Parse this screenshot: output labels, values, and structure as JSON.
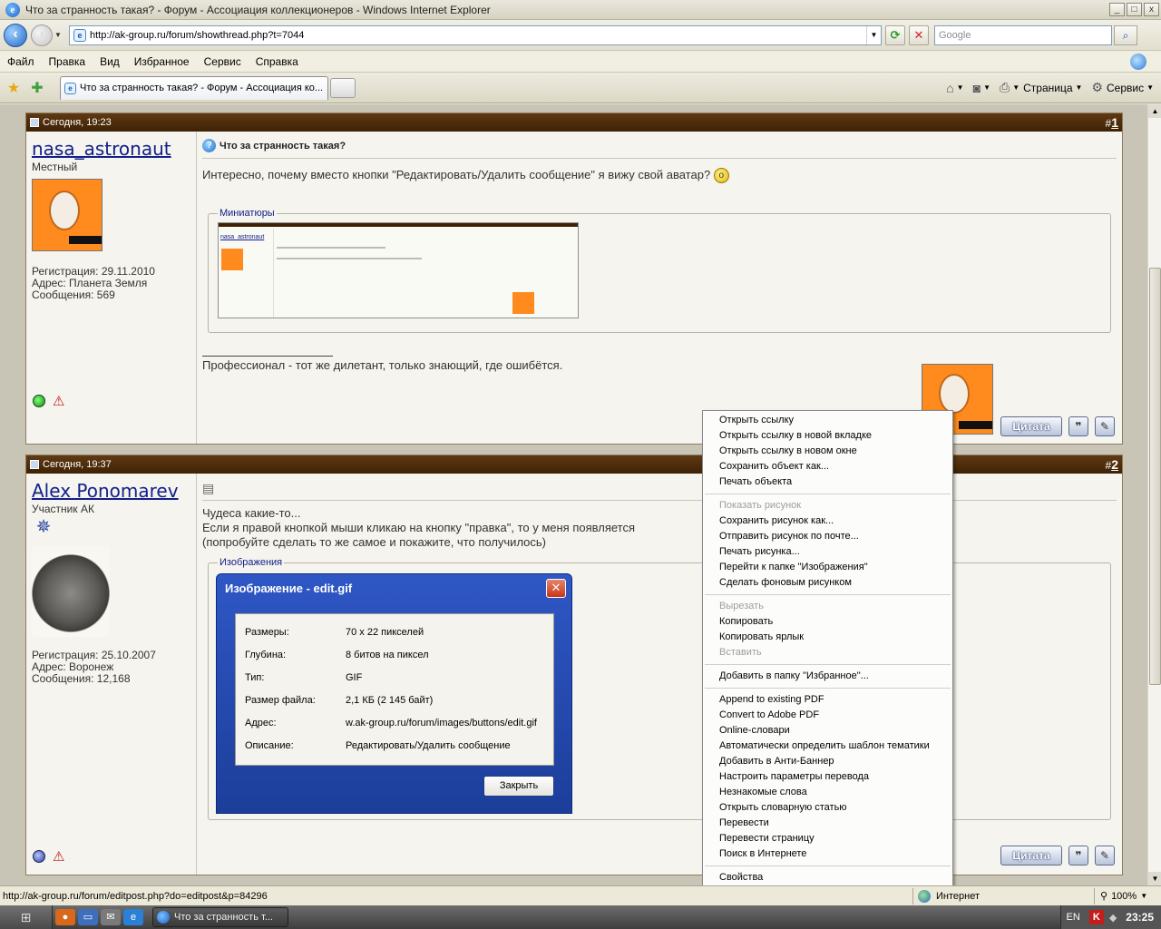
{
  "window": {
    "title": "Что за странность такая? - Форум - Ассоциация коллекционеров - Windows Internet Explorer",
    "minimize": "_",
    "maximize": "□",
    "close": "x"
  },
  "address": {
    "url": "http://ak-group.ru/forum/showthread.php?t=7044",
    "search_placeholder": "Google"
  },
  "menu": [
    "Файл",
    "Правка",
    "Вид",
    "Избранное",
    "Сервис",
    "Справка"
  ],
  "tab": {
    "label": "Что за странность такая? - Форум - Ассоциация ко..."
  },
  "toolbar_right": {
    "page": "Страница",
    "tools": "Сервис"
  },
  "posts": [
    {
      "date": "Сегодня, 19:23",
      "number_prefix": "#",
      "number": "1",
      "username": "nasa_astronaut",
      "usertitle": "Местный",
      "registration": "Регистрация: 29.11.2010",
      "location": "Адрес: Планета Земля",
      "messages": "Сообщения: 569",
      "title": "Что за странность такая?",
      "text": "Интересно, почему вместо кнопки \"Редактировать/Удалить сообщение\" я вижу свой аватар?",
      "attachment_legend": "Миниатюры",
      "thumb_username": "nasa_astronaut",
      "signature": "Профессионал - тот же дилетант, только знающий, где ошибётся.",
      "quote_button": "Цитата"
    },
    {
      "date": "Сегодня, 19:37",
      "number_prefix": "#",
      "number": "2",
      "username": "Alex Ponomarev",
      "usertitle": "Участник АК",
      "registration": "Регистрация: 25.10.2007",
      "location": "Адрес: Воронеж",
      "messages": "Сообщения: 12,168",
      "text_line1": "Чудеса какие-то...",
      "text_line2": "Если я правой кнопкой мыши кликаю на кнопку \"правка\", то у меня появляется",
      "text_line3": "(попробуйте сделать то же самое и покажите, что получилось)",
      "attachment_legend": "Изображения",
      "quote_button": "Цитата"
    }
  ],
  "context_menu": {
    "items": [
      {
        "label": "Открыть ссылку",
        "disabled": false
      },
      {
        "label": "Открыть ссылку в новой вкладке",
        "disabled": false
      },
      {
        "label": "Открыть ссылку в новом окне",
        "disabled": false
      },
      {
        "label": "Сохранить объект как...",
        "disabled": false
      },
      {
        "label": "Печать объекта",
        "disabled": false
      },
      {
        "sep": true
      },
      {
        "label": "Показать рисунок",
        "disabled": true
      },
      {
        "label": "Сохранить рисунок как...",
        "disabled": false
      },
      {
        "label": "Отправить рисунок по почте...",
        "disabled": false
      },
      {
        "label": "Печать рисунка...",
        "disabled": false
      },
      {
        "label": "Перейти к папке \"Изображения\"",
        "disabled": false
      },
      {
        "label": "Сделать фоновым рисунком",
        "disabled": false
      },
      {
        "sep": true
      },
      {
        "label": "Вырезать",
        "disabled": true
      },
      {
        "label": "Копировать",
        "disabled": false
      },
      {
        "label": "Копировать ярлык",
        "disabled": false
      },
      {
        "label": "Вставить",
        "disabled": true
      },
      {
        "sep": true
      },
      {
        "label": "Добавить в папку \"Избранное\"...",
        "disabled": false
      },
      {
        "sep": true
      },
      {
        "label": "Append to existing PDF",
        "disabled": false
      },
      {
        "label": "Convert to Adobe PDF",
        "disabled": false
      },
      {
        "label": "Online-словари",
        "disabled": false
      },
      {
        "label": "Автоматически определить шаблон тематики",
        "disabled": false
      },
      {
        "label": "Добавить в Анти-Баннер",
        "disabled": false
      },
      {
        "label": "Настроить параметры перевода",
        "disabled": false
      },
      {
        "label": "Незнакомые слова",
        "disabled": false
      },
      {
        "label": "Открыть словарную статью",
        "disabled": false
      },
      {
        "label": "Перевести",
        "disabled": false
      },
      {
        "label": "Перевести страницу",
        "disabled": false
      },
      {
        "label": "Поиск в Интернете",
        "disabled": false
      },
      {
        "sep": true
      },
      {
        "label": "Свойства",
        "disabled": false
      }
    ]
  },
  "dialog": {
    "title": "Изображение - edit.gif",
    "close_glyph": "✕",
    "rows": [
      {
        "label": "Размеры:",
        "value": "70 x 22 пикселей"
      },
      {
        "label": "Глубина:",
        "value": "8 битов на пиксел"
      },
      {
        "label": "Тип:",
        "value": "GIF"
      },
      {
        "label": "Размер файла:",
        "value": "2,1 КБ (2 145 байт)"
      },
      {
        "label": "Адрес:",
        "value": "w.ak-group.ru/forum/images/buttons/edit.gif"
      },
      {
        "label": "Описание:",
        "value": "Редактировать/Удалить сообщение"
      }
    ],
    "close_button": "Закрыть"
  },
  "status": {
    "url": "http://ak-group.ru/forum/editpost.php?do=editpost&p=84296",
    "zone": "Интернет",
    "zoom": "100%"
  },
  "taskbar": {
    "item": "Что за странность т...",
    "lang": "EN",
    "time": "23:25"
  }
}
